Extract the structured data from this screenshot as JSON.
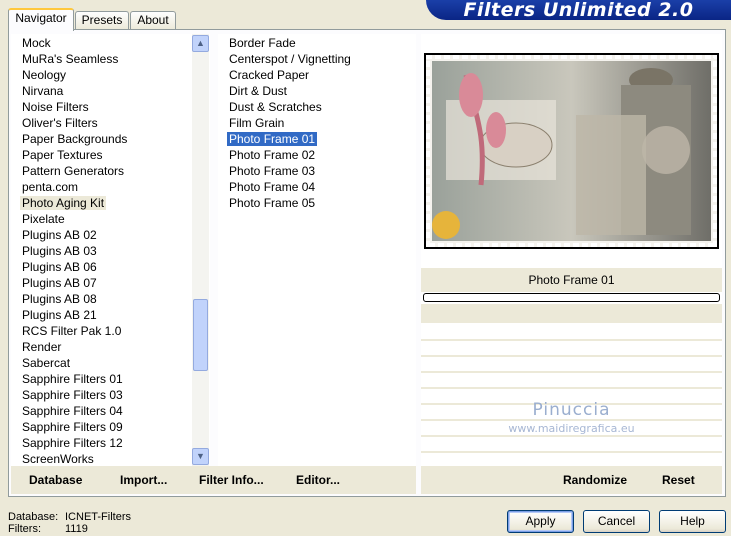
{
  "app": {
    "title": "Filters Unlimited 2.0"
  },
  "tabs": [
    {
      "label": "Navigator",
      "active": true
    },
    {
      "label": "Presets",
      "active": false
    },
    {
      "label": "About",
      "active": false
    }
  ],
  "categories": {
    "items": [
      "Mock",
      "MuRa's Seamless",
      "Neology",
      "Nirvana",
      "Noise Filters",
      "Oliver's Filters",
      "Paper Backgrounds",
      "Paper Textures",
      "Pattern Generators",
      "penta.com",
      "Photo Aging Kit",
      "Pixelate",
      "Plugins AB 02",
      "Plugins AB 03",
      "Plugins AB 06",
      "Plugins AB 07",
      "Plugins AB 08",
      "Plugins AB 21",
      "RCS Filter Pak 1.0",
      "Render",
      "Sabercat",
      "Sapphire Filters 01",
      "Sapphire Filters 03",
      "Sapphire Filters 04",
      "Sapphire Filters 09",
      "Sapphire Filters 12",
      "ScreenWorks"
    ],
    "selected": "Photo Aging Kit"
  },
  "filters": {
    "items": [
      "Border Fade",
      "Centerspot / Vignetting",
      "Cracked Paper",
      "Dirt & Dust",
      "Dust & Scratches",
      "Film Grain",
      "Photo Frame 01",
      "Photo Frame 02",
      "Photo Frame 03",
      "Photo Frame 04",
      "Photo Frame 05"
    ],
    "selected": "Photo Frame 01"
  },
  "preview": {
    "filter_name": "Photo Frame 01",
    "watermark_name": "Pinuccia",
    "watermark_url": "www.maidiregrafica.eu"
  },
  "toolbar": {
    "database": "Database",
    "import": "Import...",
    "filter_info": "Filter Info...",
    "editor": "Editor...",
    "randomize": "Randomize",
    "reset": "Reset"
  },
  "status": {
    "database_label": "Database:",
    "database_value": "ICNET-Filters",
    "filters_label": "Filters:",
    "filters_value": "1119"
  },
  "buttons": {
    "apply": "Apply",
    "cancel": "Cancel",
    "help": "Help"
  },
  "colors": {
    "selection": "#316ac5",
    "banner": "#0a2585",
    "face": "#ece9d8"
  },
  "icons": {
    "scroll_up": "chevron-up-icon",
    "scroll_down": "chevron-down-icon"
  }
}
